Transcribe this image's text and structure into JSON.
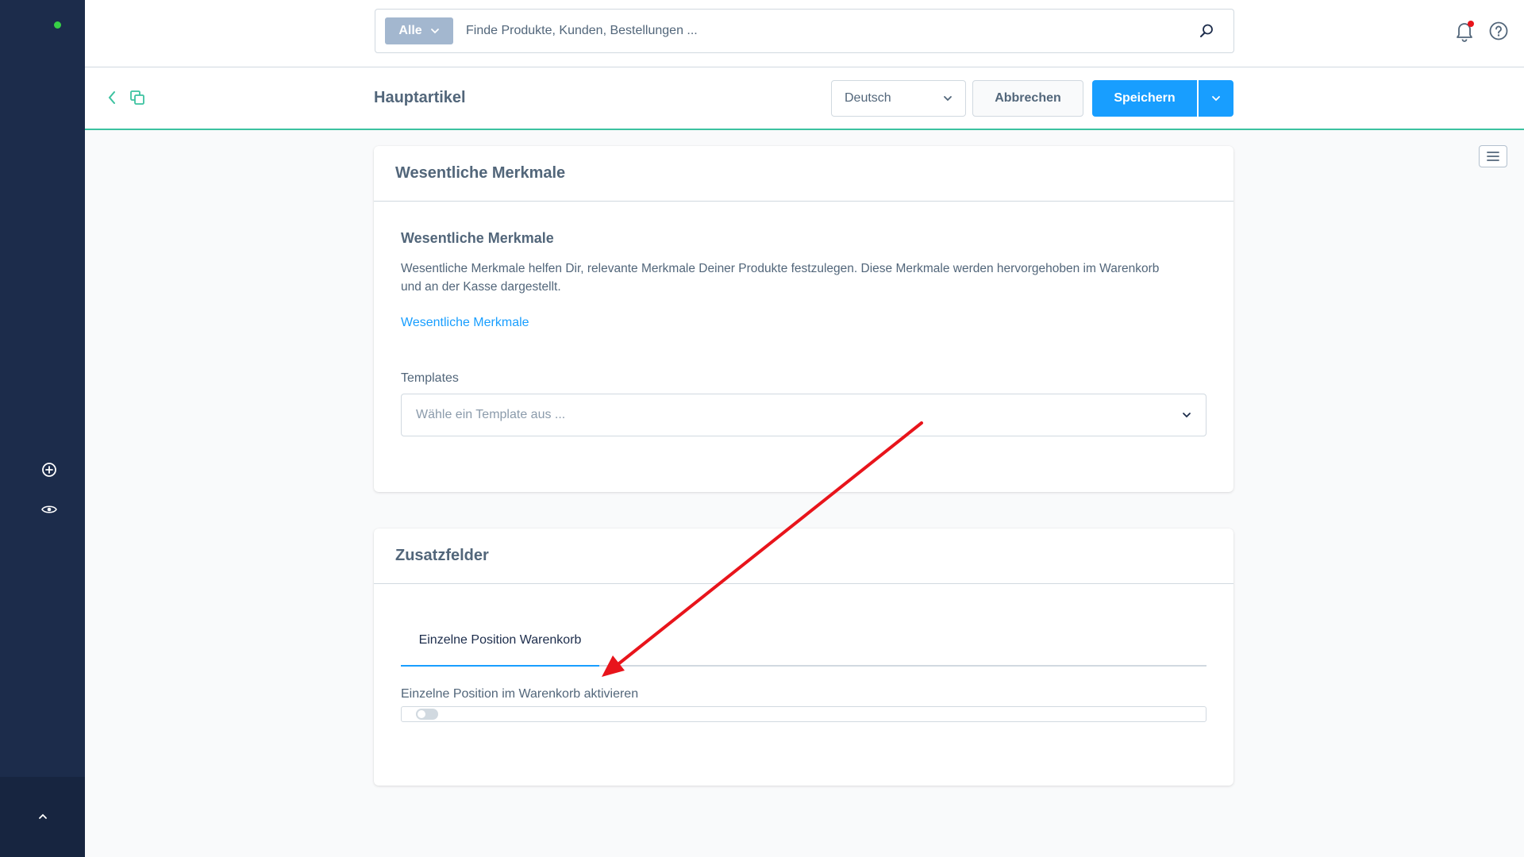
{
  "search": {
    "type_label": "Alle",
    "placeholder": "Finde Produkte, Kunden, Bestellungen ..."
  },
  "smartbar": {
    "title": "Hauptartikel",
    "language": "Deutsch",
    "cancel_label": "Abbrechen",
    "save_label": "Speichern"
  },
  "essential_card": {
    "header": "Wesentliche Merkmale",
    "subhead": "Wesentliche Merkmale",
    "description": "Wesentliche Merkmale helfen Dir, relevante Merkmale Deiner Produkte festzulegen. Diese Merkmale werden hervorgehoben im Warenkorb und an der Kasse dargestellt.",
    "link": "Wesentliche Merkmale",
    "templates_label": "Templates",
    "templates_placeholder": "Wähle ein Template aus ..."
  },
  "custom_fields_card": {
    "header": "Zusatzfelder",
    "tab_label": "Einzelne Position Warenkorb",
    "switch_label": "Einzelne Position im Warenkorb aktivieren",
    "switch_enabled": false
  },
  "colors": {
    "sidebar": "#1c2c4b",
    "accent": "#189eff",
    "status_online": "#37d046",
    "smartbar_border": "#3cc2a0",
    "annotation_arrow": "#e8141b",
    "notification_dot": "#e8141b"
  },
  "icons": [
    "plus-circle-icon",
    "eye-icon",
    "chevron-up-icon",
    "bell-icon",
    "help-icon",
    "search-icon",
    "chevron-left-icon",
    "duplicate-icon",
    "hamburger-icon",
    "chevron-down-icon"
  ]
}
